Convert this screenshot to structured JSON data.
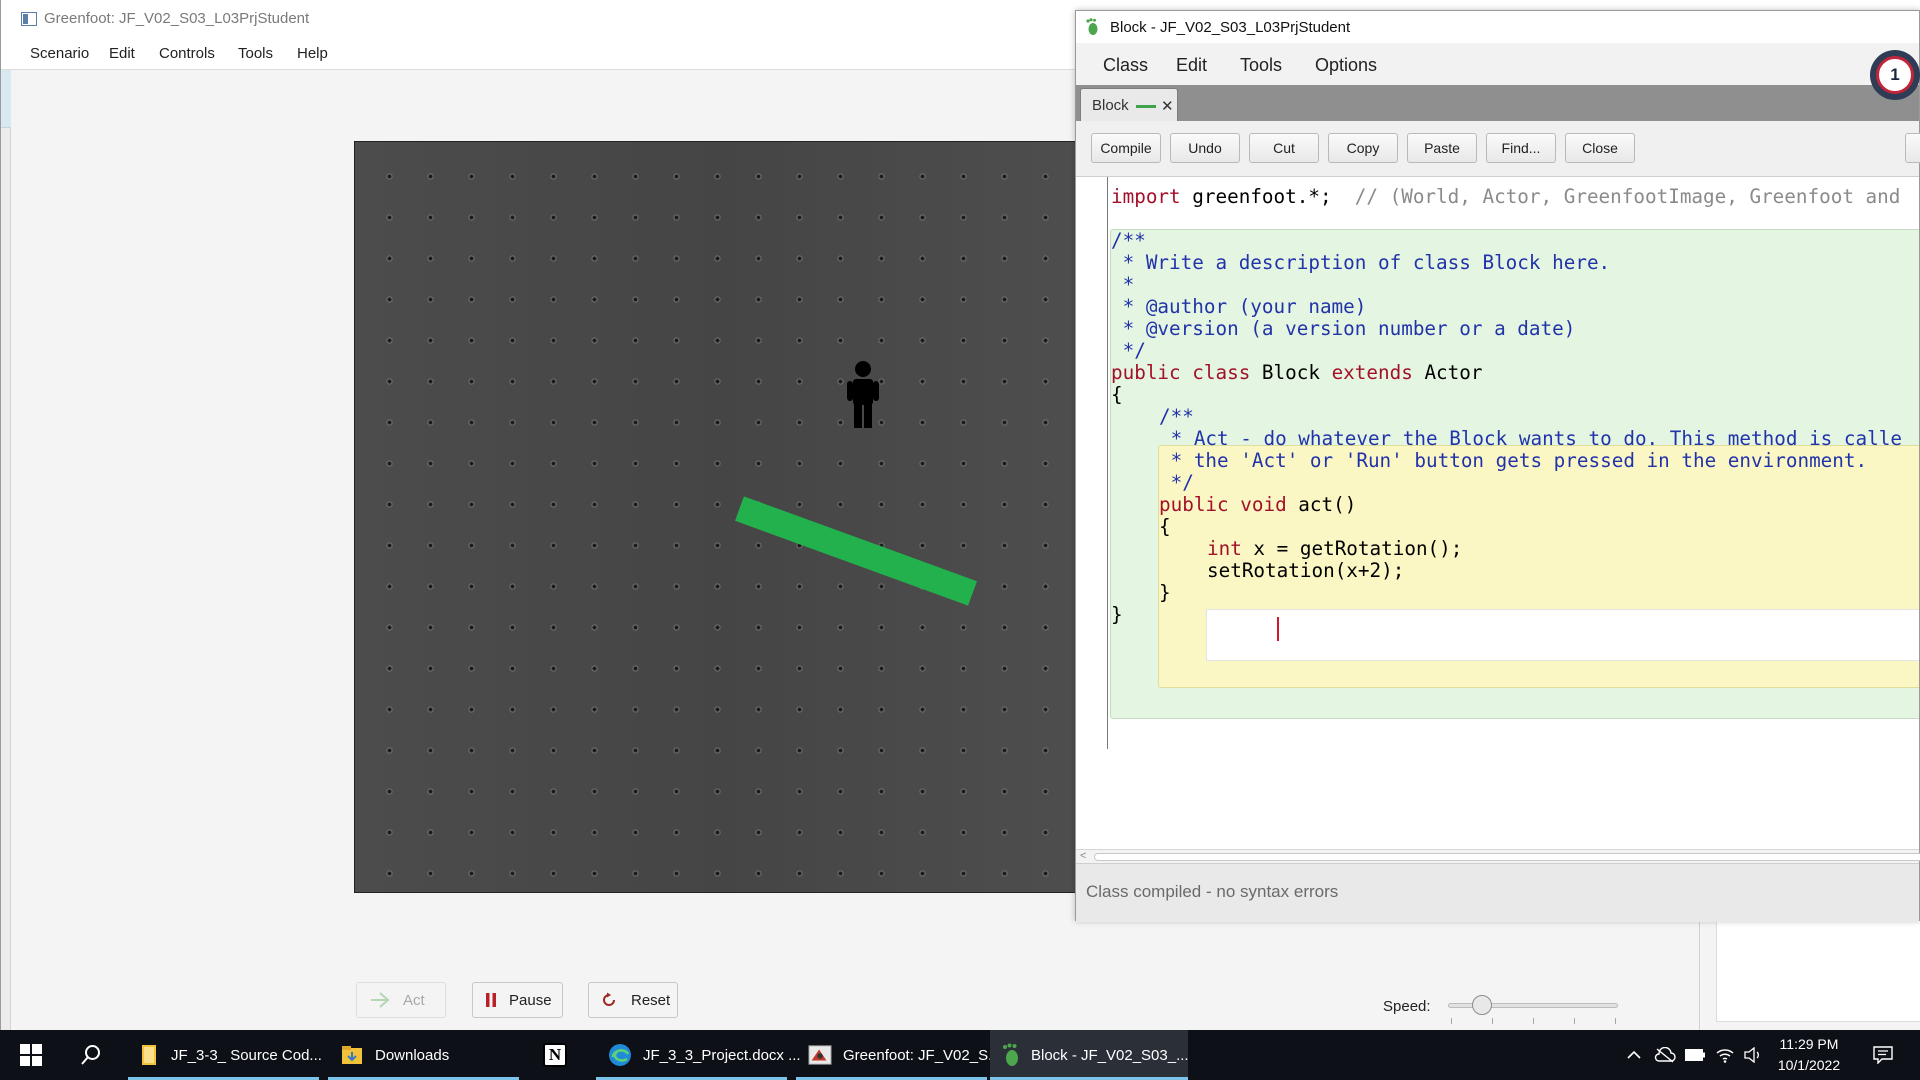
{
  "greenfoot": {
    "title": "Greenfoot: JF_V02_S03_L03PrjStudent",
    "menu": [
      "Scenario",
      "Edit",
      "Controls",
      "Tools",
      "Help"
    ],
    "controls": {
      "act_label": "Act",
      "pause_label": "Pause",
      "reset_label": "Reset",
      "speed_label": "Speed:",
      "speed_level_fraction": 0.2
    },
    "world": {
      "actors": [
        {
          "name": "person",
          "icon": "person-figure"
        },
        {
          "name": "Block",
          "color": "#22b14c",
          "rotation_deg": 20
        }
      ]
    }
  },
  "editor": {
    "title": "Block - JF_V02_S03_L03PrjStudent",
    "menu": [
      "Class",
      "Edit",
      "Tools",
      "Options"
    ],
    "tab": {
      "label": "Block",
      "close": "✕"
    },
    "toolbar": [
      "Compile",
      "Undo",
      "Cut",
      "Copy",
      "Paste",
      "Find...",
      "Close"
    ],
    "code": {
      "import_kw": "import",
      "import_rest": " greenfoot.*;  ",
      "import_comment": "// (World, Actor, GreenfootImage, Greenfoot and",
      "doc": [
        "/**",
        " * Write a description of class Block here.",
        " *",
        " * @author (your name)",
        " * @version (a version number or a date)",
        " */"
      ],
      "class_kw1": "public",
      "class_kw2": "class",
      "class_name": " Block ",
      "class_kw3": "extends",
      "class_parent": " Actor",
      "open_brace": "{",
      "close_brace": "}",
      "method_doc": [
        "/**",
        " * Act - do whatever the Block wants to do. This method is calle",
        " * the 'Act' or 'Run' button gets pressed in the environment.",
        " */"
      ],
      "method_kw1": "public",
      "method_kw2": "void",
      "method_sig": " act()",
      "body_kw": "int",
      "body_line1_rest": " x = getRotation();",
      "body_line2": "setRotation(x+2);"
    },
    "status": "Class compiled - no syntax errors",
    "notification_count": "1"
  },
  "taskbar": {
    "apps": [
      {
        "label": "JF_3-3_ Source Cod...",
        "icon": "folder-icon",
        "color": "#f2c23a"
      },
      {
        "label": "Downloads",
        "icon": "folder-download-icon",
        "color": "#f2c23a"
      },
      {
        "label": "",
        "icon": "notion-icon",
        "color": "#ffffff"
      },
      {
        "label": "JF_3_3_Project.docx ...",
        "icon": "edge-icon",
        "color": "#1f8ad6"
      },
      {
        "label": "Greenfoot: JF_V02_S...",
        "icon": "greenfoot-icon",
        "color": "#c0392b"
      },
      {
        "label": "Block - JF_V02_S03_...",
        "icon": "greenfoot-foot-icon",
        "color": "#4ca64c"
      }
    ],
    "time": "11:29 PM",
    "date": "10/1/2022"
  }
}
